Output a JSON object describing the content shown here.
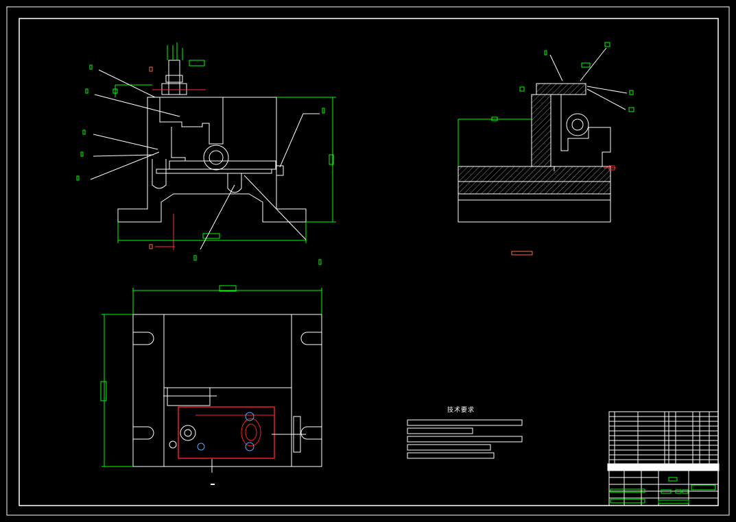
{
  "drawing": {
    "tech_requirements_title": "技术要求",
    "colors": {
      "background": "#000000",
      "line": "#ffffff",
      "dimension": "#00ff00",
      "highlight": "#ff0000",
      "accent": "#ff6a3d"
    },
    "views": [
      "front-view",
      "side-section-view",
      "top-view"
    ]
  }
}
